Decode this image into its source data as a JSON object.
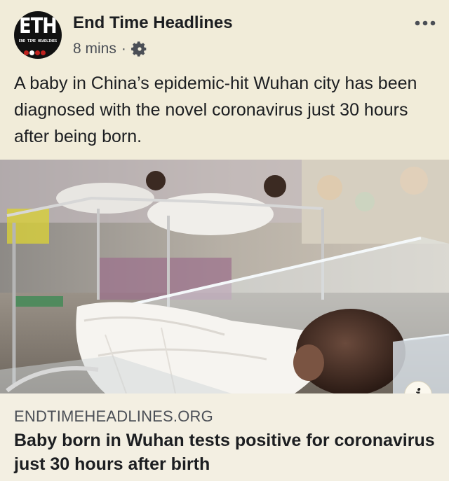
{
  "header": {
    "avatar_text": "ETH",
    "avatar_subtext": "END TIME HEADLINES",
    "page_name": "End Time Headlines",
    "time": "8 mins",
    "separator": "·",
    "audience_icon": "gear-icon",
    "more_icon": "more-options-icon"
  },
  "post": {
    "text": "A baby in China’s epidemic-hit Wuhan city has been diagnosed with the novel coronavirus just 30 hours after being born."
  },
  "link_preview": {
    "image_description_icon": "info-icon",
    "info_label": "i",
    "domain": "ENDTIMEHEADLINES.ORG",
    "title": "Baby born in Wuhan tests positive for coronavirus just 30 hours after birth"
  },
  "colors": {
    "background": "#f1ecd9",
    "text": "#1c1e21",
    "secondary_text": "#4b4f56",
    "avatar_red": "#c0221e"
  }
}
